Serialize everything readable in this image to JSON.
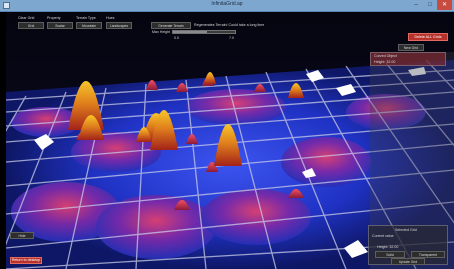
{
  "window": {
    "title": "InfinitaGrid.ap",
    "close_glyph": "✕",
    "max_glyph": "□",
    "min_glyph": "–"
  },
  "menu": {
    "items": [
      {
        "header": "Clear Grid",
        "button": "Grid"
      },
      {
        "header": "Property",
        "button": "Scalar"
      },
      {
        "header": "Terrain Type",
        "button": "Mountain"
      },
      {
        "header": "Hues",
        "button": "Landscapes"
      }
    ]
  },
  "generate": {
    "button_label": "Generate Terrain",
    "info_text": "Regenerates Terrain! Could take a long time",
    "max_height_label": "Max Height",
    "slider_min": "0.0",
    "slider_max": "7.0",
    "slider_fraction": 0.55
  },
  "right_panel": {
    "delete_button": "Delete ALL Grids",
    "new_grid_button": "New Grid",
    "list_items": [
      "Curved Object",
      "Height: 32.00"
    ]
  },
  "bottom_right_panel": {
    "title": "Selected Grid",
    "subtitle": "Current value",
    "height_label": "Height: 32.00",
    "button_left": "Solid",
    "button_right": "Transparent",
    "update_button": "Update Grid"
  },
  "bottom_left": {
    "hide_button": "Hide",
    "return_button": "Return to desktop"
  },
  "colors": {
    "peak_hi": "#f3b318",
    "peak_mid": "#c8301b",
    "lowland": "#1a2eb8",
    "grid": "#c9cbe8",
    "accent_red": "#b8322c"
  }
}
